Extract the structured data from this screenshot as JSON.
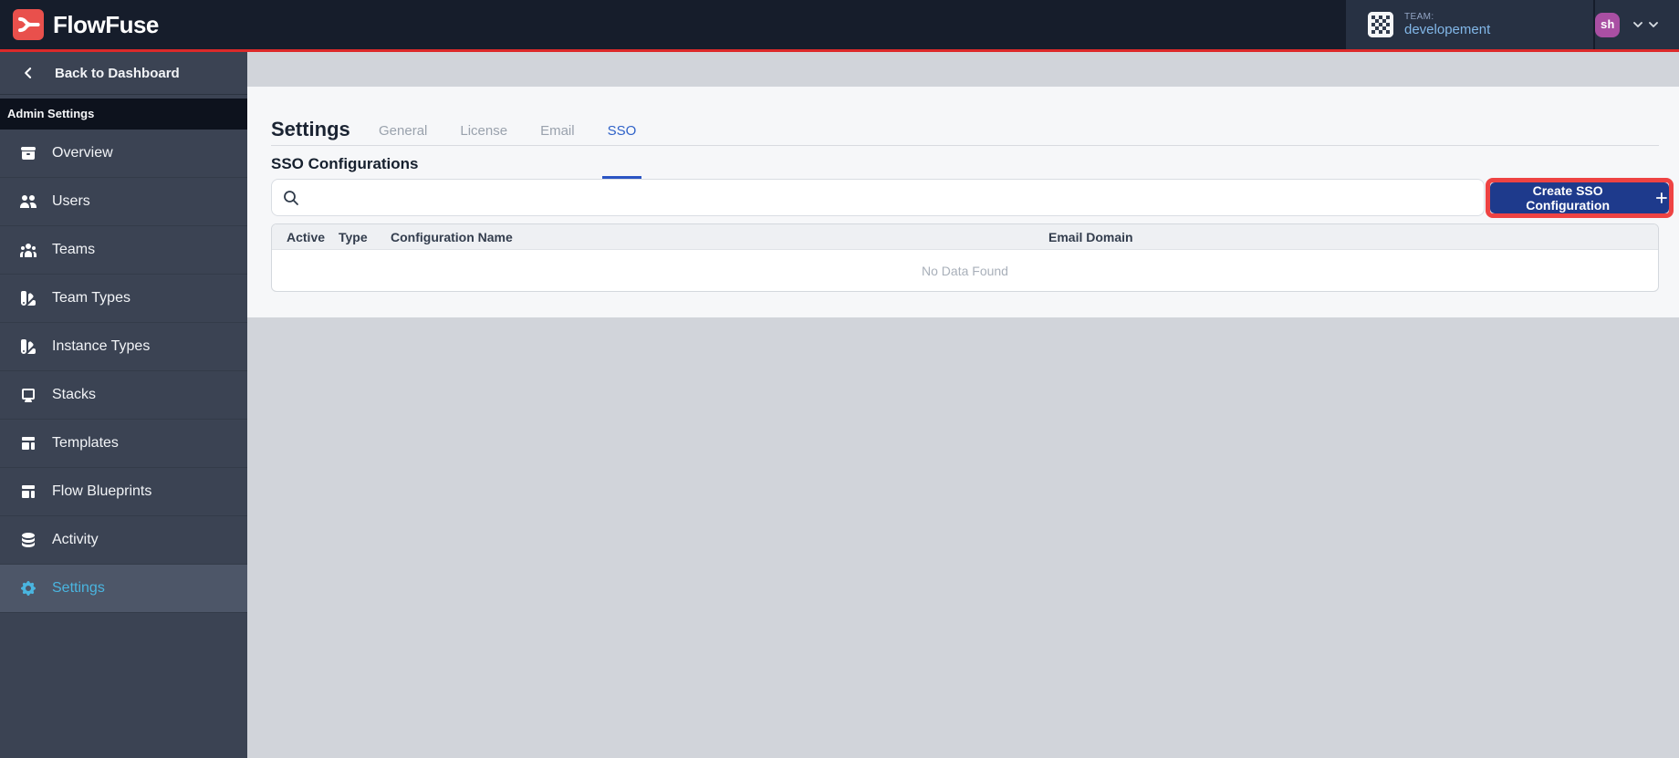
{
  "header": {
    "brand": "FlowFuse",
    "team_label": "TEAM:",
    "team_name": "developement",
    "user_initials": "sh"
  },
  "sidebar": {
    "back_label": "Back to Dashboard",
    "section_label": "Admin Settings",
    "items": [
      {
        "label": "Overview",
        "icon": "archive-icon",
        "active": false
      },
      {
        "label": "Users",
        "icon": "users-icon",
        "active": false
      },
      {
        "label": "Teams",
        "icon": "user-group-icon",
        "active": false
      },
      {
        "label": "Team Types",
        "icon": "color-swatch-icon",
        "active": false
      },
      {
        "label": "Instance Types",
        "icon": "color-swatch-icon",
        "active": false
      },
      {
        "label": "Stacks",
        "icon": "desktop-icon",
        "active": false
      },
      {
        "label": "Templates",
        "icon": "template-icon",
        "active": false
      },
      {
        "label": "Flow Blueprints",
        "icon": "template-icon",
        "active": false
      },
      {
        "label": "Activity",
        "icon": "database-icon",
        "active": false
      },
      {
        "label": "Settings",
        "icon": "cog-icon",
        "active": true
      }
    ]
  },
  "main": {
    "title": "Settings",
    "tabs": [
      {
        "label": "General",
        "active": false
      },
      {
        "label": "License",
        "active": false
      },
      {
        "label": "Email",
        "active": false
      },
      {
        "label": "SSO",
        "active": true
      }
    ],
    "section_title": "SSO Configurations",
    "search": {
      "value": "",
      "placeholder": ""
    },
    "create_button_label": "Create SSO Configuration",
    "table": {
      "columns": [
        "Active",
        "Type",
        "Configuration Name",
        "Email Domain"
      ],
      "rows": [],
      "empty_text": "No Data Found"
    }
  },
  "colors": {
    "brand_red": "#e9504c",
    "accent_line_red": "#dc2a2a",
    "annotation_red": "#ee4343",
    "button_navy": "#1e3a8c",
    "active_tab_blue": "#2f62c8",
    "sidebar_active_cyan": "#4ab5e0",
    "user_avatar_purple": "#a94fa3",
    "team_name_blue": "#82b7e8"
  }
}
